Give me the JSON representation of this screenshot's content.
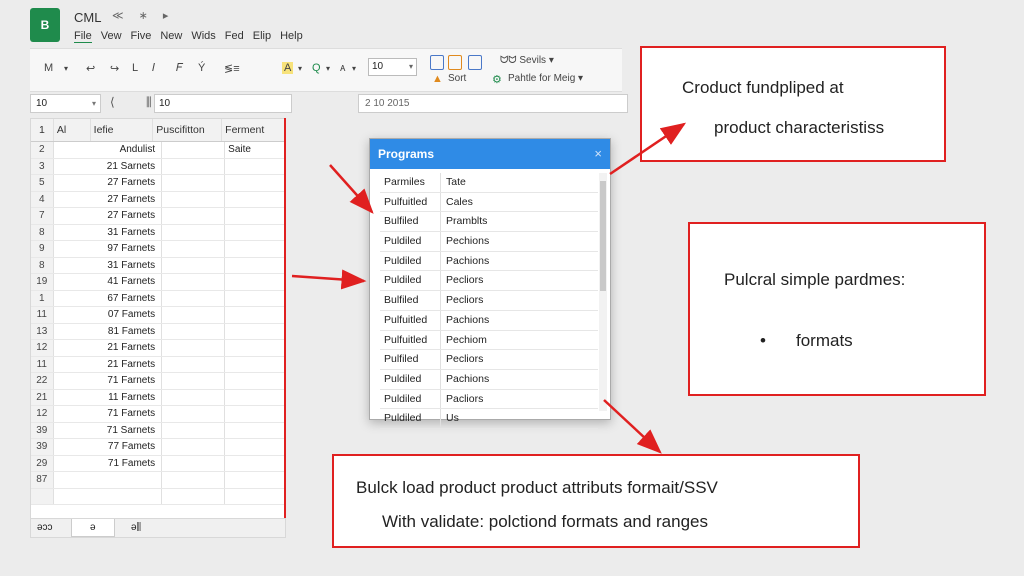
{
  "app": {
    "logo": "B",
    "title": "CML",
    "title_icons": "≪ ∗ ▸"
  },
  "menu": [
    "File",
    "Vew",
    "Five",
    "New",
    "Wids",
    "Fed",
    "Elip",
    "Help"
  ],
  "toolbar": {
    "left_tools": [
      "M",
      "▾",
      "↩",
      "↪",
      "L",
      "𝐼",
      "𝐹",
      "Ý",
      "≶≡",
      "A",
      "▾",
      "Q",
      "▾",
      "ᴀ",
      "▾"
    ],
    "font_size": "10",
    "right_tools": {
      "find_label": "ᗢᗢ Sevils",
      "find_dd": "▾",
      "sort_label": "Sort",
      "format_label": "Pahtle for Meig",
      "format_dd": "▾"
    }
  },
  "formula_bar": {
    "name_box": "10",
    "fx_icons": "⟨ ⫼",
    "formula": "10",
    "secondary": "2 10 2015"
  },
  "sheet": {
    "headers": [
      "1",
      "Al",
      "Iefie",
      "Puscifitton",
      "Ferment"
    ],
    "rows": [
      [
        "2",
        "Andulist",
        "",
        "Saite"
      ],
      [
        "3",
        "21 Sarnets",
        "",
        ""
      ],
      [
        "5",
        "27 Farnets",
        "",
        ""
      ],
      [
        "4",
        "27 Farnets",
        "",
        ""
      ],
      [
        "7",
        "27 Farnets",
        "",
        ""
      ],
      [
        "8",
        "31 Farnets",
        "",
        ""
      ],
      [
        "9",
        "97 Farnets",
        "",
        ""
      ],
      [
        "8",
        "31 Farnets",
        "",
        ""
      ],
      [
        "19",
        "41 Farnets",
        "",
        ""
      ],
      [
        "1",
        "67 Farnets",
        "",
        ""
      ],
      [
        "11",
        "07 Famets",
        "",
        ""
      ],
      [
        "13",
        "81 Famets",
        "",
        ""
      ],
      [
        "12",
        "21 Farnets",
        "",
        ""
      ],
      [
        "11",
        "21 Farnets",
        "",
        ""
      ],
      [
        "22",
        "71 Farnets",
        "",
        ""
      ],
      [
        "21",
        "11 Farnets",
        "",
        ""
      ],
      [
        "12",
        "71 Farnets",
        "",
        ""
      ],
      [
        "39",
        "71 Sarnets",
        "",
        ""
      ],
      [
        "39",
        "77 Famets",
        "",
        ""
      ],
      [
        "29",
        "71 Famets",
        "",
        ""
      ],
      [
        "87",
        "",
        "",
        ""
      ],
      [
        "",
        "",
        "",
        ""
      ]
    ],
    "tabs": {
      "left": "ǝɔɔ",
      "active": "ǝ",
      "right": "ǝ⫼"
    }
  },
  "dialog": {
    "title": "Programs",
    "close": "×",
    "rows": [
      [
        "Parmiles",
        "Tate"
      ],
      [
        "Pulfuitled",
        "Cales"
      ],
      [
        "Bulfiled",
        "Pramblts"
      ],
      [
        "Puldiled",
        "Pechions"
      ],
      [
        "Puldiled",
        "Pachions"
      ],
      [
        "Puldiled",
        "Pecliors"
      ],
      [
        "Bulfiled",
        "Pecliors"
      ],
      [
        "Pulfuitled",
        "Pachions"
      ],
      [
        "Pulfuitled",
        "Pechiom"
      ],
      [
        "Pulfiled",
        "Pecliors"
      ],
      [
        "Puldiled",
        "Pachions"
      ],
      [
        "Puldiled",
        "Pacliors"
      ],
      [
        "Puldiled",
        "Us"
      ]
    ]
  },
  "callouts": {
    "top_right": {
      "line1": "Croduct fundpliped at",
      "line2": "product characteristiss"
    },
    "middle_right": {
      "line1": "Pulcral simple pardmes:",
      "bullet": "•",
      "line2": "formats"
    },
    "bottom": {
      "line1": "Bulck load product product attributs formait/SSV",
      "line2": "With validate: polctiond formats and ranges"
    }
  },
  "colors": {
    "accent_red": "#e02020",
    "dialog_blue": "#2f8be6",
    "logo_green": "#1f8b4c"
  }
}
